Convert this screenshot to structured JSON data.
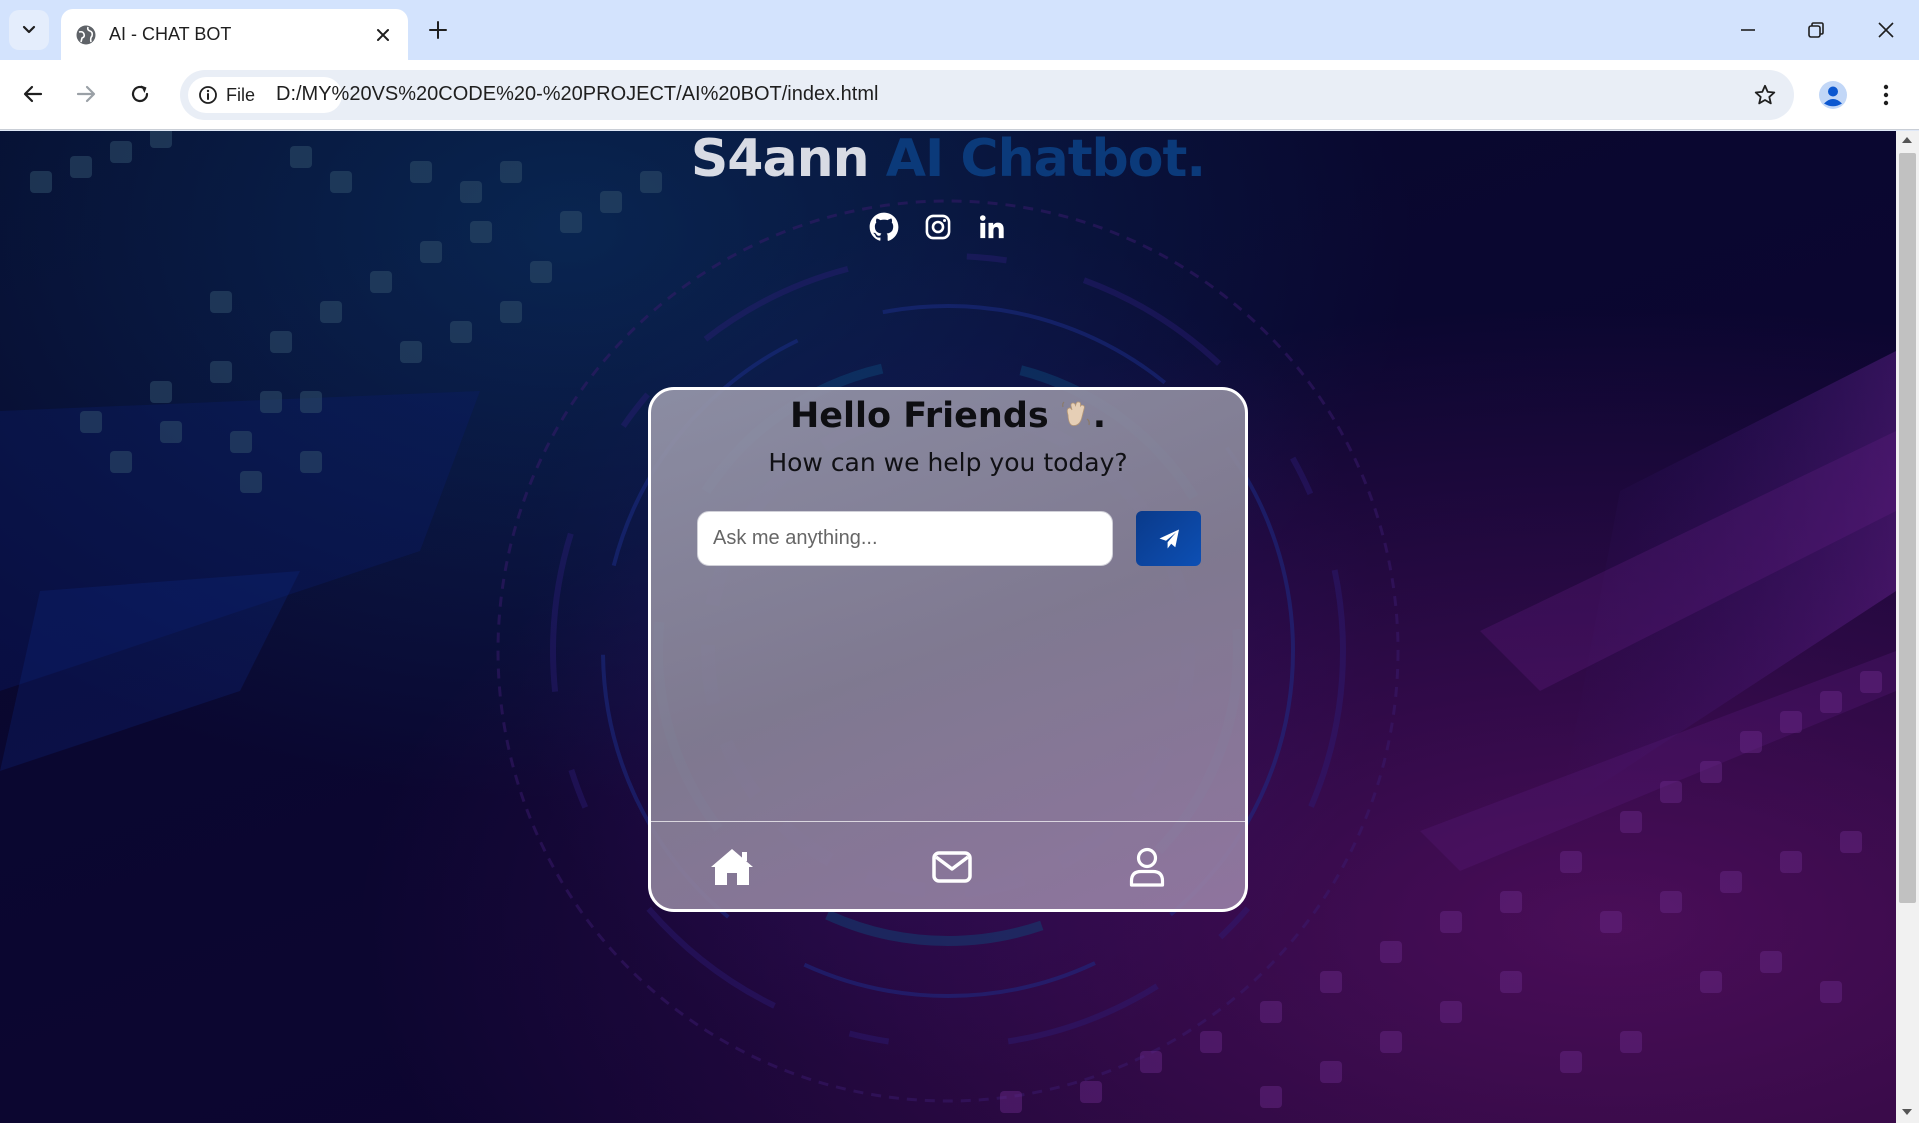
{
  "browser": {
    "tab_title": "AI - CHAT BOT",
    "chip_label": "File",
    "url": "D:/MY%20VS%20CODE%20-%20PROJECT/AI%20BOT/index.html",
    "icons": [
      "tab-search-icon",
      "globe-icon",
      "close-icon",
      "plus-icon",
      "minimize-icon",
      "restore-icon",
      "back-icon",
      "forward-icon",
      "reload-icon",
      "info-icon",
      "star-icon",
      "profile-icon",
      "more-vert-icon"
    ]
  },
  "page": {
    "brand_part1": "S4ann",
    "brand_part2": "AI Chatbot.",
    "social_icons": [
      "github-icon",
      "instagram-icon",
      "linkedin-icon"
    ],
    "card": {
      "title": "Hello Friends",
      "title_suffix": ".",
      "subtitle": "How can we help you today?",
      "input_placeholder": "Ask me anything...",
      "input_value": "",
      "nav_icons": [
        "home-icon",
        "mail-icon",
        "user-icon"
      ]
    },
    "colors": {
      "brand_accent": "#0b3a7a",
      "send_button": "#0d4fb4",
      "card_border": "#ffffff"
    }
  }
}
